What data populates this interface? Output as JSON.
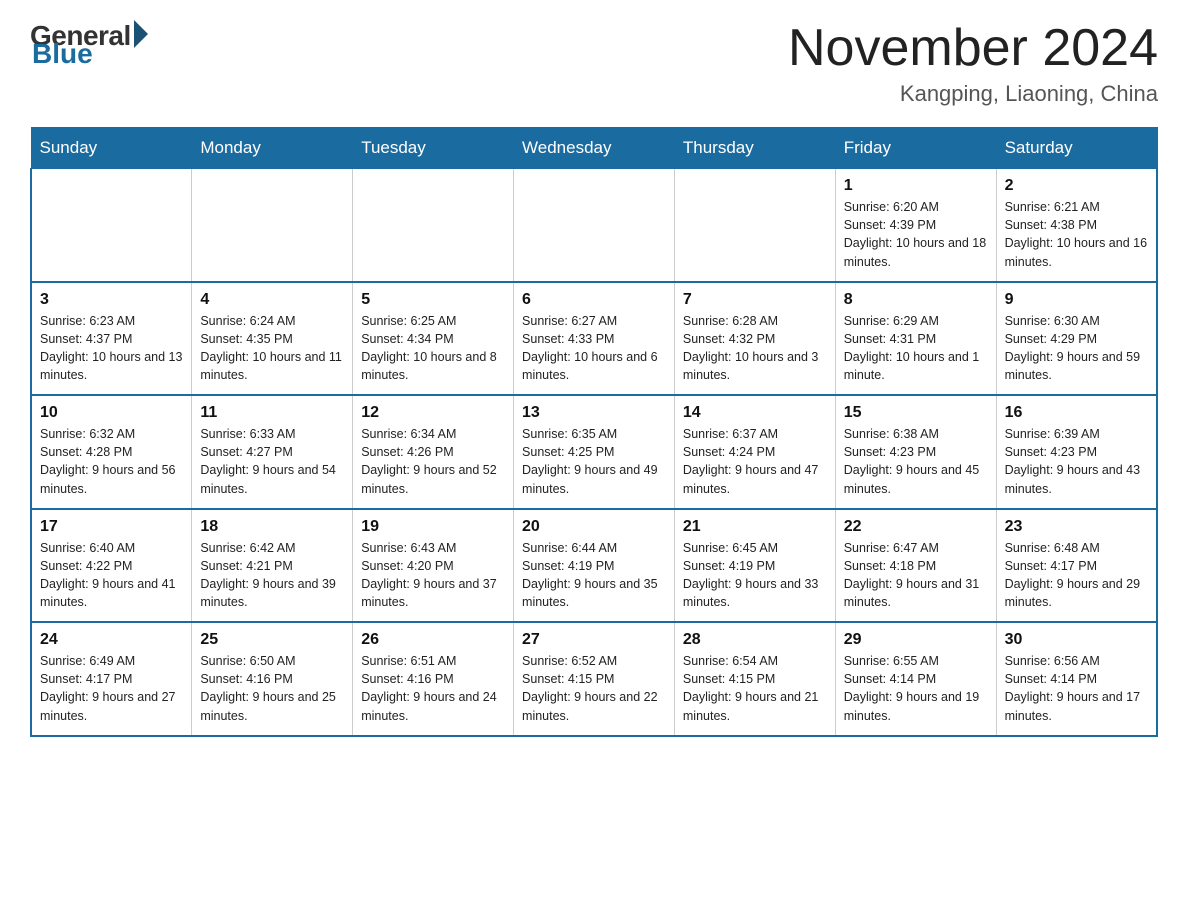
{
  "logo": {
    "general": "General",
    "blue": "Blue"
  },
  "title": "November 2024",
  "location": "Kangping, Liaoning, China",
  "days_of_week": [
    "Sunday",
    "Monday",
    "Tuesday",
    "Wednesday",
    "Thursday",
    "Friday",
    "Saturday"
  ],
  "weeks": [
    [
      {
        "day": "",
        "info": ""
      },
      {
        "day": "",
        "info": ""
      },
      {
        "day": "",
        "info": ""
      },
      {
        "day": "",
        "info": ""
      },
      {
        "day": "",
        "info": ""
      },
      {
        "day": "1",
        "info": "Sunrise: 6:20 AM\nSunset: 4:39 PM\nDaylight: 10 hours and 18 minutes."
      },
      {
        "day": "2",
        "info": "Sunrise: 6:21 AM\nSunset: 4:38 PM\nDaylight: 10 hours and 16 minutes."
      }
    ],
    [
      {
        "day": "3",
        "info": "Sunrise: 6:23 AM\nSunset: 4:37 PM\nDaylight: 10 hours and 13 minutes."
      },
      {
        "day": "4",
        "info": "Sunrise: 6:24 AM\nSunset: 4:35 PM\nDaylight: 10 hours and 11 minutes."
      },
      {
        "day": "5",
        "info": "Sunrise: 6:25 AM\nSunset: 4:34 PM\nDaylight: 10 hours and 8 minutes."
      },
      {
        "day": "6",
        "info": "Sunrise: 6:27 AM\nSunset: 4:33 PM\nDaylight: 10 hours and 6 minutes."
      },
      {
        "day": "7",
        "info": "Sunrise: 6:28 AM\nSunset: 4:32 PM\nDaylight: 10 hours and 3 minutes."
      },
      {
        "day": "8",
        "info": "Sunrise: 6:29 AM\nSunset: 4:31 PM\nDaylight: 10 hours and 1 minute."
      },
      {
        "day": "9",
        "info": "Sunrise: 6:30 AM\nSunset: 4:29 PM\nDaylight: 9 hours and 59 minutes."
      }
    ],
    [
      {
        "day": "10",
        "info": "Sunrise: 6:32 AM\nSunset: 4:28 PM\nDaylight: 9 hours and 56 minutes."
      },
      {
        "day": "11",
        "info": "Sunrise: 6:33 AM\nSunset: 4:27 PM\nDaylight: 9 hours and 54 minutes."
      },
      {
        "day": "12",
        "info": "Sunrise: 6:34 AM\nSunset: 4:26 PM\nDaylight: 9 hours and 52 minutes."
      },
      {
        "day": "13",
        "info": "Sunrise: 6:35 AM\nSunset: 4:25 PM\nDaylight: 9 hours and 49 minutes."
      },
      {
        "day": "14",
        "info": "Sunrise: 6:37 AM\nSunset: 4:24 PM\nDaylight: 9 hours and 47 minutes."
      },
      {
        "day": "15",
        "info": "Sunrise: 6:38 AM\nSunset: 4:23 PM\nDaylight: 9 hours and 45 minutes."
      },
      {
        "day": "16",
        "info": "Sunrise: 6:39 AM\nSunset: 4:23 PM\nDaylight: 9 hours and 43 minutes."
      }
    ],
    [
      {
        "day": "17",
        "info": "Sunrise: 6:40 AM\nSunset: 4:22 PM\nDaylight: 9 hours and 41 minutes."
      },
      {
        "day": "18",
        "info": "Sunrise: 6:42 AM\nSunset: 4:21 PM\nDaylight: 9 hours and 39 minutes."
      },
      {
        "day": "19",
        "info": "Sunrise: 6:43 AM\nSunset: 4:20 PM\nDaylight: 9 hours and 37 minutes."
      },
      {
        "day": "20",
        "info": "Sunrise: 6:44 AM\nSunset: 4:19 PM\nDaylight: 9 hours and 35 minutes."
      },
      {
        "day": "21",
        "info": "Sunrise: 6:45 AM\nSunset: 4:19 PM\nDaylight: 9 hours and 33 minutes."
      },
      {
        "day": "22",
        "info": "Sunrise: 6:47 AM\nSunset: 4:18 PM\nDaylight: 9 hours and 31 minutes."
      },
      {
        "day": "23",
        "info": "Sunrise: 6:48 AM\nSunset: 4:17 PM\nDaylight: 9 hours and 29 minutes."
      }
    ],
    [
      {
        "day": "24",
        "info": "Sunrise: 6:49 AM\nSunset: 4:17 PM\nDaylight: 9 hours and 27 minutes."
      },
      {
        "day": "25",
        "info": "Sunrise: 6:50 AM\nSunset: 4:16 PM\nDaylight: 9 hours and 25 minutes."
      },
      {
        "day": "26",
        "info": "Sunrise: 6:51 AM\nSunset: 4:16 PM\nDaylight: 9 hours and 24 minutes."
      },
      {
        "day": "27",
        "info": "Sunrise: 6:52 AM\nSunset: 4:15 PM\nDaylight: 9 hours and 22 minutes."
      },
      {
        "day": "28",
        "info": "Sunrise: 6:54 AM\nSunset: 4:15 PM\nDaylight: 9 hours and 21 minutes."
      },
      {
        "day": "29",
        "info": "Sunrise: 6:55 AM\nSunset: 4:14 PM\nDaylight: 9 hours and 19 minutes."
      },
      {
        "day": "30",
        "info": "Sunrise: 6:56 AM\nSunset: 4:14 PM\nDaylight: 9 hours and 17 minutes."
      }
    ]
  ]
}
